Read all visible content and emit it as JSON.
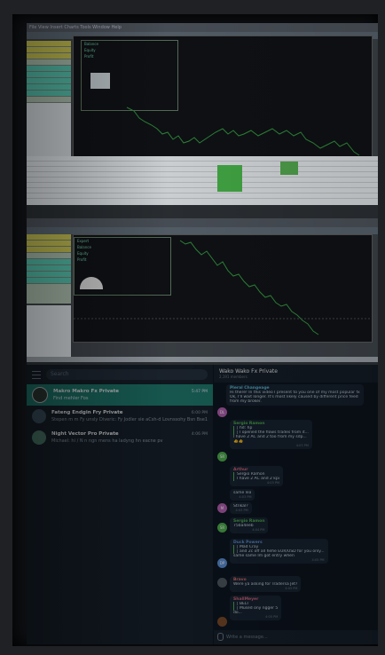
{
  "telegram": {
    "search_placeholder": "Search",
    "chats": [
      {
        "title": "Makro Makro Fx Private",
        "preview": "Find mehler Fos",
        "time": "5:47 PM",
        "selected": true,
        "avatar_color": "#2e3a36"
      },
      {
        "title": "Fateng Endgin Fry Private",
        "preview": "Stepen m m Fy unsly Diveric: Fy Jodler sie aCsh-d Lovnssohy Bsn Bse1",
        "time": "6:00 PM",
        "selected": false,
        "avatar_color": "#3a4f5e"
      },
      {
        "title": "Night Vector Pro Private",
        "preview": "Michael: hi / N n ngn mens ha ladyng hn eacne pv",
        "time": "4:06 PM",
        "selected": false,
        "avatar_color": "#4a7a6a"
      }
    ],
    "conversation": {
      "title": "Wako Wako Fx Private",
      "subtitle": "2,191 members",
      "messages": [
        {
          "author": "Pleral Changeage",
          "author_color": "#5bb8d4",
          "lines": [
            "Hi there! In this video I present to you one of my most popular fx",
            "Ok, I'll wait longer. It's most likely caused by different price feed",
            "from my broker."
          ],
          "time": "",
          "avatar": "DL",
          "avatar_color": "#b35fb0"
        },
        {
          "author": "Sergio Ramon",
          "author_color": "#4fae4e",
          "lines": [
            "| hd: hp",
            "| I opened the flows trades from it...",
            "I have 2 AC and 2 too from my sdp...",
            "👍👍"
          ],
          "time": "4:03 PM",
          "avatar": "SR",
          "avatar_color": "#4fae4e"
        },
        {
          "author": "Arthur",
          "author_color": "#d2637a",
          "lines": [
            "Sergio Ramon",
            "I have 2 AC and 2 kpi"
          ],
          "time": "4:03 PM",
          "avatar": "",
          "avatar_color": ""
        },
        {
          "author": "",
          "author_color": "",
          "lines": [
            "same lea"
          ],
          "time": "4:03 PM",
          "avatar": "",
          "avatar_color": ""
        },
        {
          "author": "",
          "author_color": "",
          "lines": [
            "Strikal?"
          ],
          "time": "4:03 PM",
          "avatar": "M",
          "avatar_color": "#b35fb0"
        },
        {
          "author": "Sergio Ramon",
          "author_color": "#4fae4e",
          "lines": [
            "75ba4eeb"
          ],
          "time": "4:04 PM",
          "avatar": "SR",
          "avatar_color": "#4fae4e"
        },
        {
          "author": "Duck Powers",
          "author_color": "#5b8fd4",
          "lines": [
            "| Mad Cray",
            "| and 2c off all hehe EUR/USD for you only...",
            "same same Im got entry when"
          ],
          "time": "4:05 PM",
          "avatar": "DP",
          "avatar_color": "#5b8fd4"
        },
        {
          "author": "Bravo",
          "author_color": "#d26b6b",
          "lines": [
            "Were ya asking for Tradersa Jet?"
          ],
          "time": "4:05 PM",
          "avatar": "",
          "avatar_color": "#4e5a62"
        },
        {
          "author": "ShallMeyer",
          "author_color": "#d2637a",
          "lines": [
            "| BELT",
            "| Mused ony ngger 5",
            "do..."
          ],
          "time": "4:05 PM",
          "avatar": "",
          "avatar_color": "#7a4a2a"
        }
      ],
      "compose_placeholder": "Write a message..."
    }
  },
  "mt4": {
    "menu": "File  View  Insert  Charts  Tools  Window  Help",
    "info_lines_top": [
      "Balance",
      "Equity",
      "Profit"
    ],
    "info_lines_bottom": [
      "Expert",
      "Balance",
      "Equity",
      "Profit"
    ]
  }
}
